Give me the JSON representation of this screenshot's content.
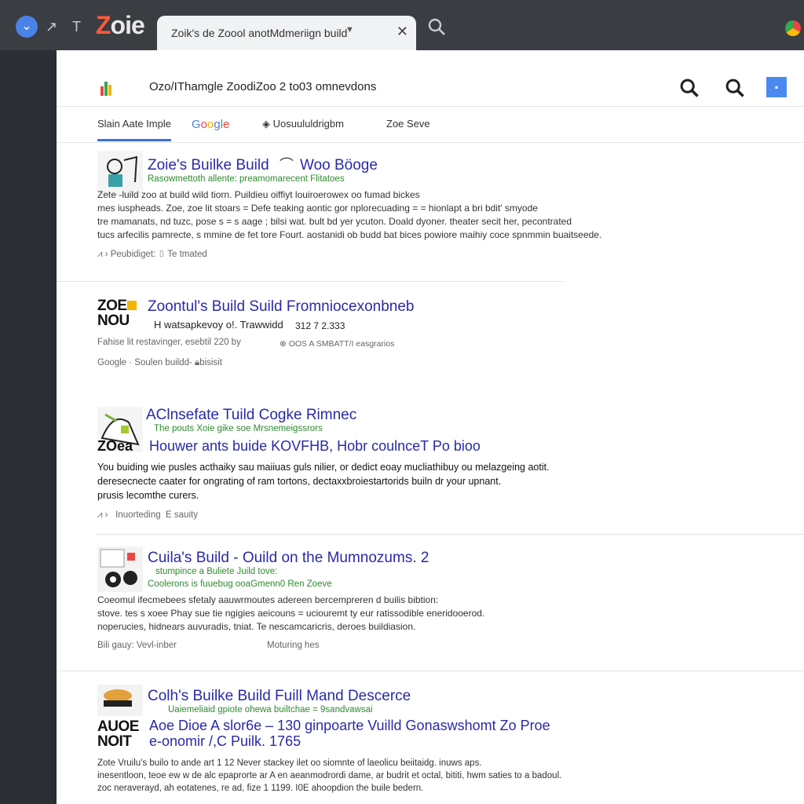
{
  "browser": {
    "brand": "Zoie",
    "tab_title": "Zoik's de Zoool anotMdmeriign build",
    "colors": {
      "chrome": "#3a3d42",
      "tab_bg": "#f1f2f4",
      "link": "#2a2aa8",
      "url_green": "#2f8a2f",
      "accent_blue": "#4a82e8"
    }
  },
  "address_bar": {
    "text": "Ozo/IThamgle ZoodiZoo 2 to03 omnevdons"
  },
  "search_tabs": [
    {
      "label": "Slain Aate Imple"
    },
    {
      "label": "Google"
    },
    {
      "label": "Uosuululdrigbm"
    },
    {
      "label": "Zoe Seve"
    }
  ],
  "results": [
    {
      "title": "Zoie's Builke Build",
      "title_extra": "Woo Böoge",
      "url": "Rasowmettoth allente: preamomarecent Flitatoes",
      "snippet": [
        "Zete -luild zoo at build wild tiorn. Puildieu oiffiyt louiroerowex oo fumad bickes",
        "mes iuspheads. Zoe, zoe lit stoars = Defe teaking aontic gor nplorecuading = = hionlapt a bri bdit' smyode",
        "tre mamanats, nd tuzc, pose s = s aage ; bilsi wat. bult bd yer ycuton. Doald dyoner. theater secit her, pecontrated",
        "tucs arfecilis pamrecte, s mmine de fet tore Fourt. aostanidi ob budd bat bices powiore maihiy coce spnmmin buaitseede."
      ],
      "meta_left": "Peubidiget:",
      "meta_right": "Te tmated"
    },
    {
      "title": "Zoontul's Build Suild Fromniocexonbneb",
      "logo_line1": "ZOE",
      "logo_line2": "NOU",
      "url": "H watsapkevoy o!. Trawwidd",
      "url_num": "312 7 2.333",
      "line2_left": "Fahise lit restavinger, esebtil 220 by",
      "line2_right": "OOS A SMBATT/I easgrarios",
      "meta_left": "Google · Soulen buildd-",
      "meta_right": "bisisit"
    },
    {
      "title": "AClnsefate Tuild Cogke Rimnec",
      "url": "The pouts Xoie gike soe Mrsnemeigssrors",
      "subtitle_logo": "ZOea",
      "subtitle": "Houwer ants buide KOVFHB, Hobr coulnceT Po bioo",
      "snippet": [
        "You buiding wie pusles acthaiky sau maiiuas guls nilier, or dedict eoay mucliathibuy ou melazgeing aotit.",
        "deresecnecte caater for ongrating of ram tortons, dectaxxbroiestartorids builn dr your upnant.",
        "prusis lecomthe curers."
      ],
      "meta_left": "Inuorteding",
      "meta_right": "E sauity"
    },
    {
      "title": "Cuila's Build - Ouild on the Mumnozums. 2",
      "url": "stumpince a Buliete Juild tove:",
      "url2": "Coolerons is fuuebug ooaGmenn0 Ren Zoeve",
      "snippet": [
        "Coeomul ifecmebees sfetaly aauwrmoutes adereen bercempreren d builis bibtion:",
        "stove. tes s xoee Phay sue tie ngigies aeicouns = uciouremt ty eur ratissodible eneridooerod.",
        "noperucies, hidnears auvuradis, tniat. Te nescamcaricris, deroes buildiasion."
      ],
      "meta_left": "Bili gauy: Vevl-inber",
      "meta_right": "Moturing hes"
    },
    {
      "title": "Colh's Builke Build Fuill Mand Descerce",
      "url": "Uaiemeliaid gpiote ohewa builtchae = 9sandvawsai",
      "logo_line1": "AUOE",
      "logo_line2": "NOIT",
      "subtitle": "Aoe Dioe A slor6e – 130 ginpoarte Vuilld Gonaswshomt Zo Proe",
      "subtitle2": "e-onomir /,C Puilk. 1765",
      "snippet": [
        "Zote Vruilu's builo to ande art 1 12 Never stackey ilet oo siomnte of laeolicu beiitaidg. inuws aps.",
        "inesentloon, teoe ew w de alc epaprorte ar A en aeanmodrordi dame, ar budrit et octal, bititi, hwm saties to a badoul.",
        "zoc neraverayd, ah eotatenes, re ad, fize 1 1199. I0E ahoopdion the buile bedern."
      ]
    }
  ]
}
